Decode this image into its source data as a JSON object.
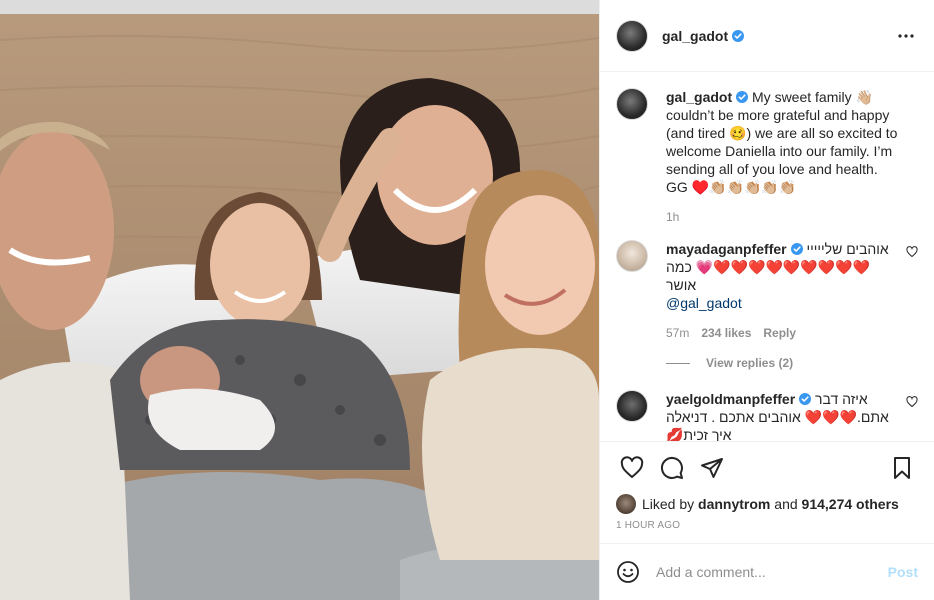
{
  "post": {
    "username": "gal_gadot",
    "verified": true,
    "more_icon": "more-horizontal-icon"
  },
  "caption": {
    "username": "gal_gadot",
    "text": "My sweet family 👋🏼 couldn’t be more grateful and happy (and tired 🥴) we are all so excited to welcome Daniella into our family. I’m sending all of you love and health. GG ♥️👏🏼👏🏼👏🏼👏🏼👏🏼",
    "time": "1h"
  },
  "comments": [
    {
      "username": "mayadaganpfeffer",
      "text": "אוהבים שלייייי ❤️❤️❤️❤️❤️❤️❤️❤️❤️💗 כמה אושר",
      "mention": "@gal_gadot",
      "time": "57m",
      "likes": "234 likes",
      "reply": "Reply",
      "view_replies": "View replies (2)"
    },
    {
      "username": "yaelgoldmanpfeffer",
      "text": "איזה דבר אתם.❤️❤️❤️ אוהבים אתכם . דניאלה איך זכית💋",
      "time": "",
      "likes": "",
      "reply": ""
    }
  ],
  "liked_by": {
    "prefix": "Liked by",
    "user": "dannytrom",
    "middle": "and",
    "count": "914,274 others"
  },
  "timestamp": "1 HOUR AGO",
  "add_comment": {
    "placeholder": "Add a comment...",
    "post_label": "Post"
  },
  "colors": {
    "verified": "#3897f0",
    "link": "#00376b",
    "post_disabled": "#b2dffc"
  }
}
